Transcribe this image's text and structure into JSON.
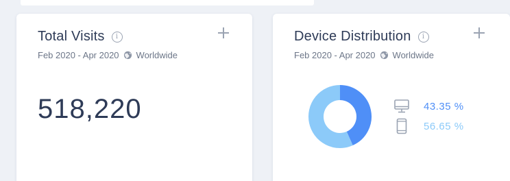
{
  "colors": {
    "desktop": "#4f8ff7",
    "mobile": "#8ccaf9",
    "title": "#2e3b57",
    "muted": "#9aa3b2"
  },
  "visits_card": {
    "title": "Total Visits",
    "date_range": "Feb 2020 - Apr 2020",
    "region": "Worldwide",
    "value": "518,220"
  },
  "devices_card": {
    "title": "Device Distribution",
    "date_range": "Feb 2020 - Apr 2020",
    "region": "Worldwide",
    "items": [
      {
        "icon": "desktop-icon",
        "label": "43.35 %",
        "share": 43.35
      },
      {
        "icon": "mobile-icon",
        "label": "56.65 %",
        "share": 56.65
      }
    ]
  }
}
